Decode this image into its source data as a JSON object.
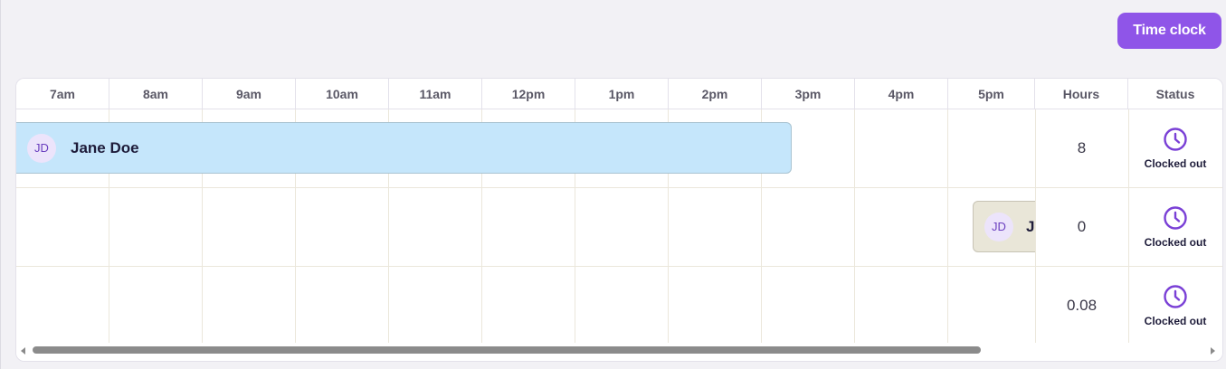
{
  "actions": {
    "time_clock_label": "Time clock"
  },
  "header": {
    "columns": [
      "7am",
      "8am",
      "9am",
      "10am",
      "11am",
      "12pm",
      "1pm",
      "2pm",
      "3pm",
      "4pm",
      "5pm"
    ],
    "hours_label": "Hours",
    "status_label": "Status"
  },
  "rows": [
    {
      "avatar_initials": "JD",
      "name": "Jane Doe",
      "hours": "8",
      "status": "Clocked out",
      "status_icon": "clock-icon"
    },
    {
      "avatar_initials": "JD",
      "name": "Jane Doe",
      "hours": "0",
      "status": "Clocked out",
      "status_icon": "clock-icon"
    },
    {
      "hours": "0.08",
      "status": "Clocked out",
      "status_icon": "clock-icon"
    }
  ],
  "colors": {
    "accent": "#8f55e8",
    "shift_blue": "#c5e6fb",
    "shift_beige": "#e9e6d8",
    "status_icon": "#7a40d6"
  }
}
